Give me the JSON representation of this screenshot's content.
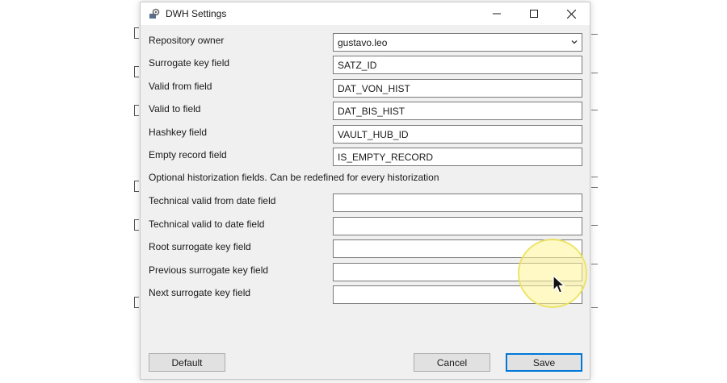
{
  "window": {
    "title": "DWH Settings",
    "icon": "app-settings-icon",
    "controls": [
      "minimize-icon",
      "maximize-icon",
      "close-icon"
    ]
  },
  "fields": [
    {
      "label": "Repository owner",
      "value": "gustavo.leo",
      "type": "select"
    },
    {
      "label": "Surrogate key field",
      "value": "SATZ_ID",
      "type": "text"
    },
    {
      "label": "Valid from field",
      "value": "DAT_VON_HIST",
      "type": "text"
    },
    {
      "label": "Valid to field",
      "value": "DAT_BIS_HIST",
      "type": "text"
    },
    {
      "label": "Hashkey field",
      "value": "VAULT_HUB_ID",
      "type": "text"
    },
    {
      "label": "Empty record field",
      "value": "IS_EMPTY_RECORD",
      "type": "text"
    }
  ],
  "optional_note": "Optional historization fields. Can be redefined for every historization",
  "optional_fields": [
    {
      "label": "Technical valid from date field",
      "value": ""
    },
    {
      "label": "Technical valid to date field",
      "value": ""
    },
    {
      "label": "Root surrogate key field",
      "value": ""
    },
    {
      "label": "Previous surrogate key field",
      "value": ""
    },
    {
      "label": "Next surrogate key field",
      "value": ""
    }
  ],
  "buttons": {
    "default_label": "Default",
    "cancel_label": "Cancel",
    "save_label": "Save"
  },
  "colors": {
    "accent": "#0078d7",
    "dialog_bg": "#f0f0f0",
    "cursor_highlight": "#fff596"
  }
}
